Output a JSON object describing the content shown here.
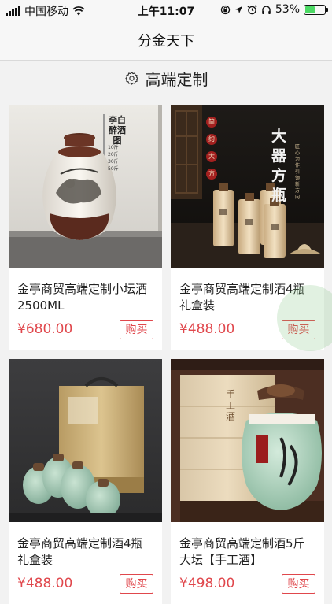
{
  "status_bar": {
    "carrier": "中国移动",
    "time": "上午11:07",
    "battery_percent": "53%",
    "battery_level": 0.53,
    "icons": [
      "signal-icon",
      "wifi-icon",
      "screen-lock-icon",
      "location-icon",
      "alarm-icon",
      "headphones-icon",
      "battery-icon"
    ],
    "battery_color": "#4cd964"
  },
  "nav": {
    "title": "分金天下"
  },
  "section": {
    "title": "高端定制",
    "icon": "gear-icon"
  },
  "products": [
    {
      "name": "金亭商贸高端定制小坛酒2500ML",
      "price": "¥680.00",
      "buy_label": "购买",
      "image_text": {
        "title": "李白醉酒图",
        "sizes": [
          "10斤",
          "20斤",
          "30斤",
          "50斤"
        ]
      }
    },
    {
      "name": "金亭商贸高端定制酒4瓶礼盒装",
      "price": "¥488.00",
      "buy_label": "购买",
      "image_text": {
        "title": "大器方瓶",
        "badges": [
          "简",
          "约",
          "大",
          "方"
        ],
        "subtitle": "匠心为作，引领新方向"
      }
    },
    {
      "name": "金亭商贸高端定制酒4瓶礼盒装",
      "price": "¥488.00",
      "buy_label": "购买",
      "image_text": {}
    },
    {
      "name": "金亭商贸高端定制酒5斤大坛【手工酒】",
      "price": "¥498.00",
      "buy_label": "购买",
      "image_text": {
        "title": "手工酒"
      }
    }
  ],
  "colors": {
    "accent": "#e0474c",
    "background": "#f2f2f2",
    "card_bg": "#ffffff"
  }
}
